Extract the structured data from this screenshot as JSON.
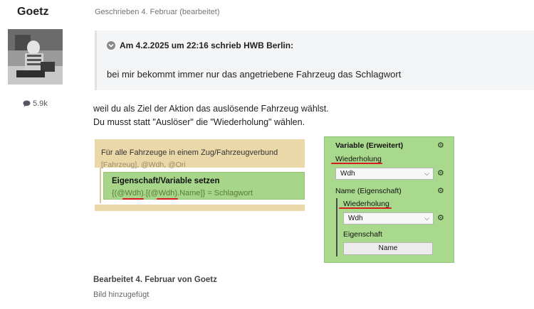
{
  "author": {
    "name": "Goetz",
    "reaction_count": "5.9k"
  },
  "post": {
    "meta": "Geschrieben 4. Februar (bearbeitet)"
  },
  "quote": {
    "header": "Am 4.2.2025 um 22:16 schrieb HWB Berlin:",
    "text": "bei mir bekommt immer nur das angetriebene Fahrzeug das Schlagwort"
  },
  "body": {
    "line1": "weil du als Ziel der Aktion das auslösende Fahrzeug wählst.",
    "line2": "Du musst statt \"Auslöser\" die \"Wiederholung\" wählen."
  },
  "image": {
    "loop_title": "Für alle Fahrzeuge in einem Zug/Fahrzeugverbund",
    "loop_params": "[Fahrzeug], @Wdh, @Ori",
    "action_title": "Eigenschaft/Variable setzen",
    "action_params": "{(@Wdh).[(@Wdh).Name]} = Schlagwort",
    "panel": {
      "title": "Variable (Erweitert)",
      "label_wiederholung_1": "Wiederholung",
      "select1_value": "Wdh",
      "label_name": "Name (Eigenschaft)",
      "label_wiederholung_2": "Wiederholung",
      "select2_value": "Wdh",
      "label_eigenschaft": "Eigenschaft",
      "name_button": "Name"
    }
  },
  "footer": {
    "edited_by": "Bearbeitet 4. Februar von Goetz",
    "edit_reason": "Bild hinzugefügt"
  },
  "colors": {
    "annotation_red": "#d81b1b",
    "green_panel": "#a9d98c",
    "yellow_block": "#ead8a8"
  }
}
